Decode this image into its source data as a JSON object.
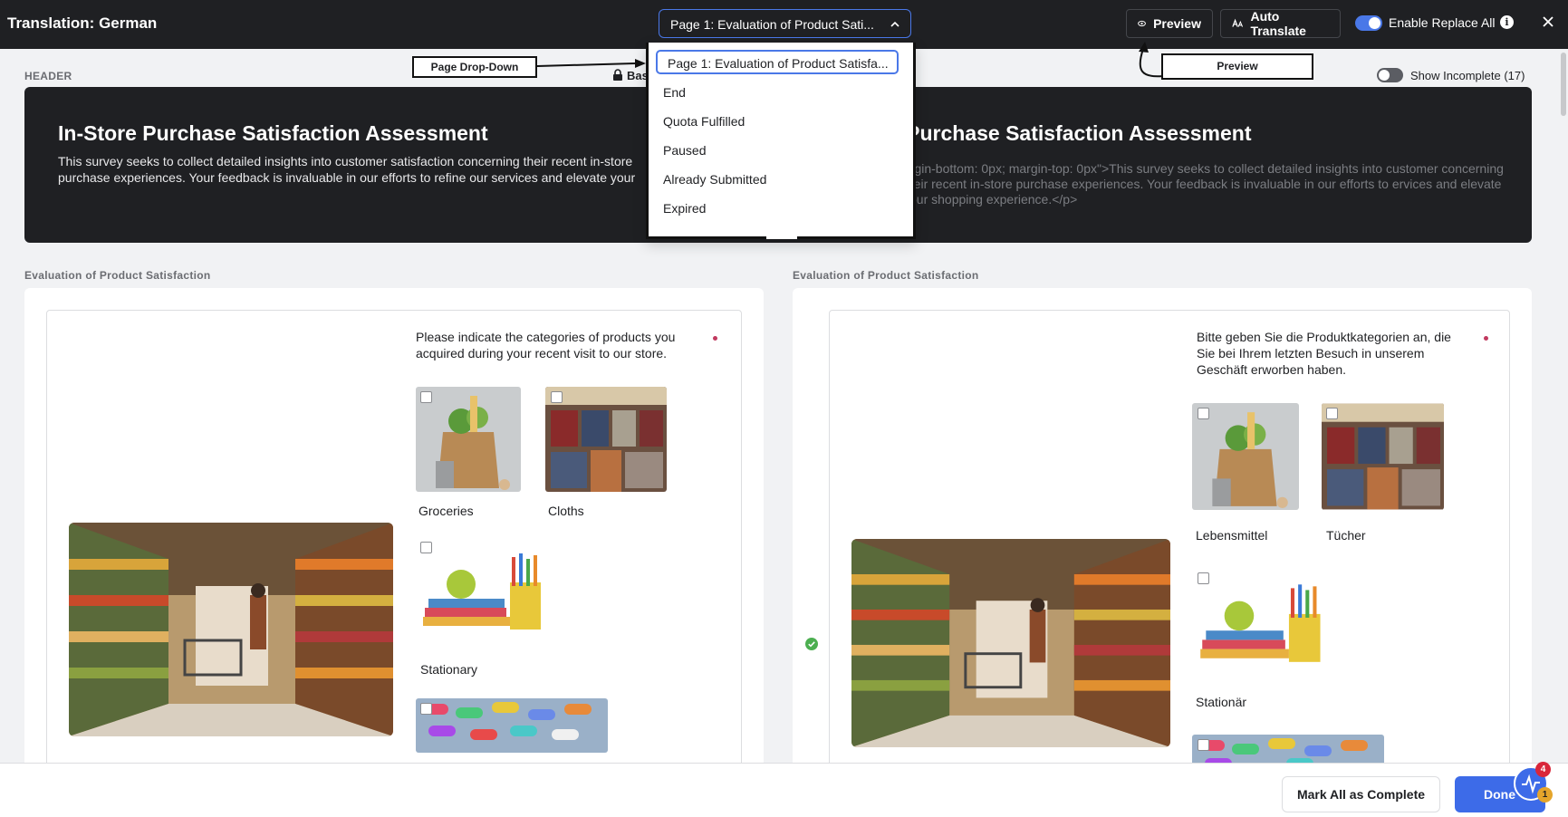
{
  "topbar": {
    "title": "Translation: German",
    "page_select_value": "Page 1: Evaluation of Product Sati...",
    "preview_label": "Preview",
    "auto_translate_label": "Auto Translate",
    "enable_replace_label": "Enable Replace All",
    "enable_replace_on": true
  },
  "dropdown": {
    "items": [
      "Page 1: Evaluation of Product Satisfa...",
      "End",
      "Quota Fulfilled",
      "Paused",
      "Already Submitted",
      "Expired"
    ],
    "selected_index": 0
  },
  "annotations": {
    "page_dropdown": "Page Drop-Down",
    "preview": "Preview"
  },
  "header_section": {
    "label": "HEADER",
    "base_label": "Base",
    "show_incomplete_label": "Show Incomplete (17)",
    "show_incomplete_on": false
  },
  "banner": {
    "left_title": "In-Store Purchase Satisfaction Assessment",
    "left_desc": "This survey seeks to collect detailed insights into customer satisfaction concerning their recent in-store purchase experiences. Your feedback is invaluable in our efforts to refine our services and elevate your shopping experience.",
    "right_title": "re Purchase Satisfaction Assessment",
    "right_desc": "argin-bottom: 0px; margin-top: 0px\">This survey seeks to collect detailed insights into customer concerning their recent in-store purchase experiences. Your feedback is invaluable in our efforts to ervices and elevate your shopping experience.</p>"
  },
  "left_panel": {
    "section_label": "Evaluation of Product Satisfaction",
    "question": "Please indicate the categories of products you acquired during your recent visit to our store.",
    "options": [
      "Groceries",
      "Cloths",
      "Stationary"
    ]
  },
  "right_panel": {
    "section_label": "Evaluation of Product Satisfaction",
    "question": "Bitte geben Sie die Produktkategorien an, die Sie bei Ihrem letzten Besuch in unserem Geschäft erworben haben.",
    "options": [
      "Lebensmittel",
      "Tücher",
      "Stationär"
    ]
  },
  "footer": {
    "mark_all_label": "Mark All as Complete",
    "done_label": "Done",
    "badge_red": "4",
    "badge_yellow": "1"
  },
  "colors": {
    "accent": "#3d6be8",
    "dark_bar": "#1f2023",
    "required": "#c1395f",
    "success": "#4caf50"
  }
}
